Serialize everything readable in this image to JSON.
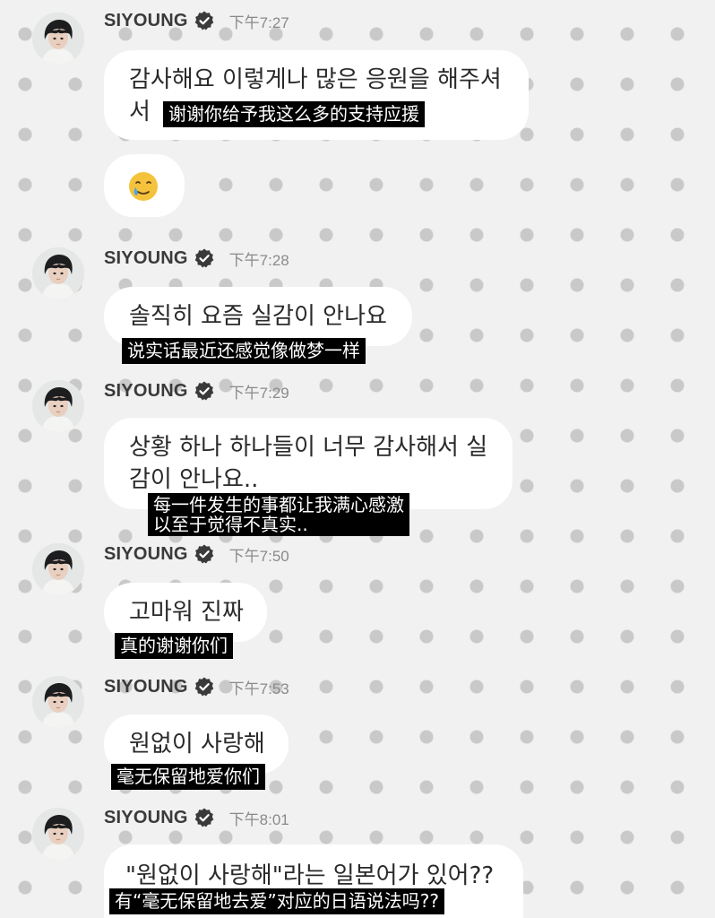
{
  "chat": {
    "colors": {
      "background": "#f1f1f1",
      "dots": "#c9c9c9",
      "bubble": "#ffffff",
      "subtitle_bg": "#000000",
      "subtitle_text": "#ffffff",
      "time_text": "#8a8a8a"
    },
    "messages": [
      {
        "sender": "SIYOUNG",
        "verified_icon": "verified-badge-icon",
        "time": "下午7:27",
        "bubbles": [
          {
            "lines": [
              "감사해요 이렇게나 많은 응원을 해주셔",
              "서"
            ],
            "subtitle": [
              "谢谢你给予我这么多的支持应援"
            ]
          },
          {
            "emoji": "face-holding-back-tears-icon"
          }
        ]
      },
      {
        "sender": "SIYOUNG",
        "verified_icon": "verified-badge-icon",
        "time": "下午7:28",
        "bubbles": [
          {
            "lines": [
              "솔직히 요즘 실감이 안나요"
            ],
            "subtitle": [
              "说实话最近还感觉像做梦一样"
            ]
          }
        ]
      },
      {
        "sender": "SIYOUNG",
        "verified_icon": "verified-badge-icon",
        "time": "下午7:29",
        "bubbles": [
          {
            "lines": [
              "상황 하나 하나들이 너무 감사해서 실",
              "감이 안나요.."
            ],
            "subtitle": [
              "每一件发生的事都让我满心感激",
              "以至于觉得不真实.."
            ]
          }
        ]
      },
      {
        "sender": "SIYOUNG",
        "verified_icon": "verified-badge-icon",
        "time": "下午7:50",
        "bubbles": [
          {
            "lines": [
              "고마워 진짜"
            ],
            "subtitle": [
              "真的谢谢你们"
            ]
          }
        ]
      },
      {
        "sender": "SIYOUNG",
        "verified_icon": "verified-badge-icon",
        "time": "下午7:53",
        "bubbles": [
          {
            "lines": [
              "원없이 사랑해"
            ],
            "subtitle": [
              "毫无保留地爱你们"
            ]
          }
        ]
      },
      {
        "sender": "SIYOUNG",
        "verified_icon": "verified-badge-icon",
        "time": "下午8:01",
        "bubbles": [
          {
            "lines": [
              "\"원없이 사랑해\"라는 일본어가 있어??"
            ],
            "subtitle": [
              "有“毫无保留地去爱”对应的日语说法吗??"
            ]
          }
        ]
      }
    ]
  }
}
